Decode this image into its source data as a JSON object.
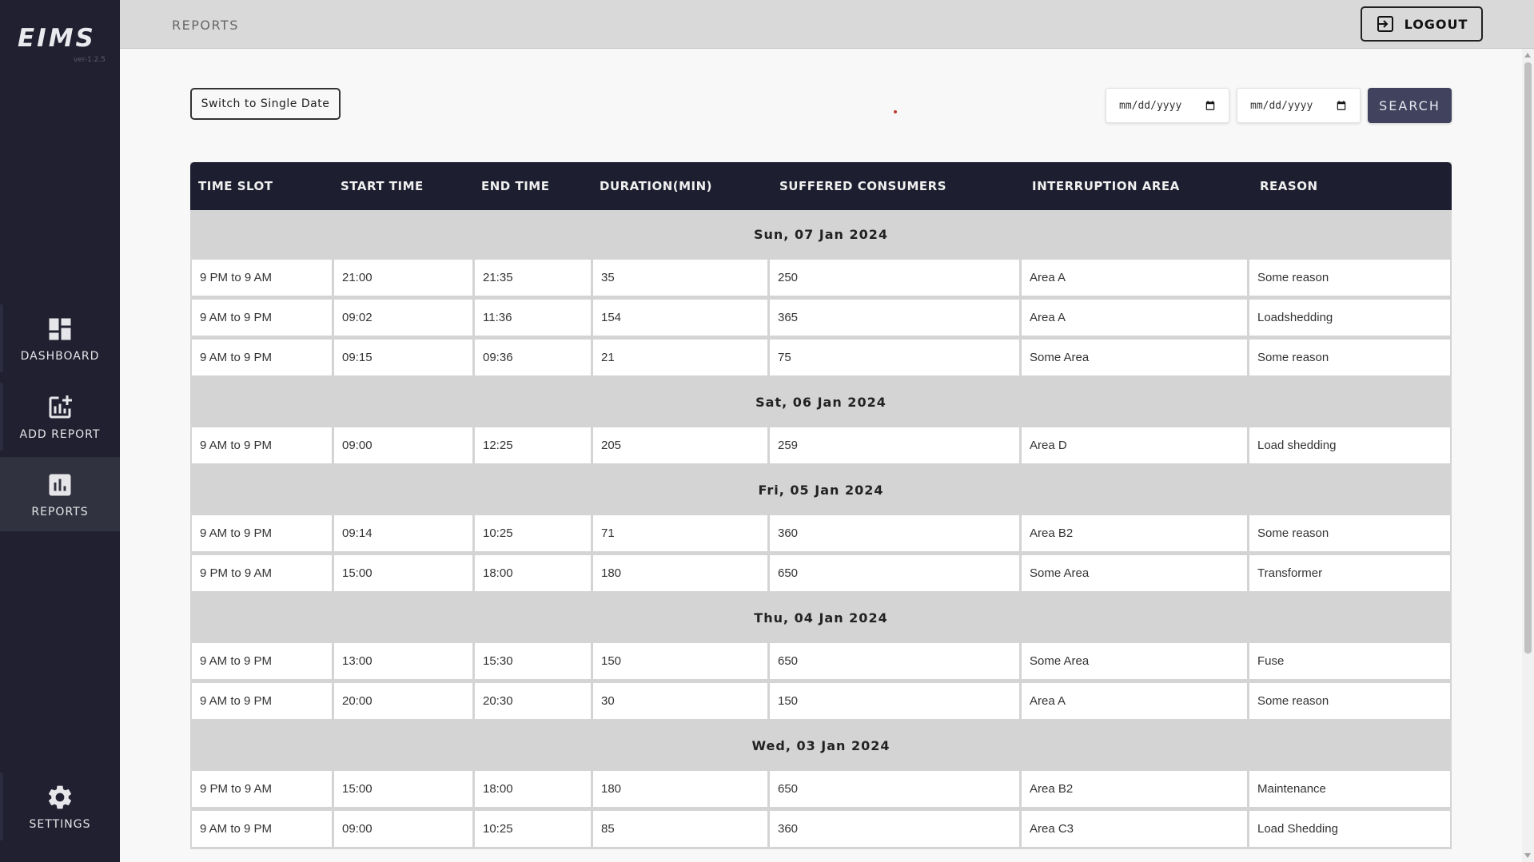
{
  "app": {
    "logo": "EIMS",
    "version": "ver-1.2.5"
  },
  "sidebar": {
    "items": [
      {
        "label": "DASHBOARD",
        "icon": "dashboard-icon"
      },
      {
        "label": "ADD REPORT",
        "icon": "add-chart-icon"
      },
      {
        "label": "REPORTS",
        "icon": "bar-chart-icon",
        "active": true
      },
      {
        "label": "SETTINGS",
        "icon": "gear-icon"
      }
    ]
  },
  "header": {
    "title": "REPORTS",
    "logout_label": "LOGOUT"
  },
  "controls": {
    "switch_label": "Switch to Single Date",
    "date_from_placeholder": "mm/dd/yyyy",
    "date_to_placeholder": "mm/dd/yyyy",
    "search_label": "SEARCH"
  },
  "table": {
    "columns": [
      "TIME SLOT",
      "START TIME",
      "END TIME",
      "DURATION(MIN)",
      "SUFFERED CONSUMERS",
      "INTERRUPTION AREA",
      "REASON"
    ],
    "groups": [
      {
        "date": "Sun, 07 Jan 2024",
        "rows": [
          [
            "9 PM to 9 AM",
            "21:00",
            "21:35",
            "35",
            "250",
            "Area A",
            "Some reason"
          ],
          [
            "9 AM to 9 PM",
            "09:02",
            "11:36",
            "154",
            "365",
            "Area A",
            "Loadshedding"
          ],
          [
            "9 AM to 9 PM",
            "09:15",
            "09:36",
            "21",
            "75",
            "Some Area",
            "Some reason"
          ]
        ]
      },
      {
        "date": "Sat, 06 Jan 2024",
        "rows": [
          [
            "9 AM to 9 PM",
            "09:00",
            "12:25",
            "205",
            "259",
            "Area D",
            "Load shedding"
          ]
        ]
      },
      {
        "date": "Fri, 05 Jan 2024",
        "rows": [
          [
            "9 AM to 9 PM",
            "09:14",
            "10:25",
            "71",
            "360",
            "Area B2",
            "Some reason"
          ],
          [
            "9 PM to 9 AM",
            "15:00",
            "18:00",
            "180",
            "650",
            "Some Area",
            "Transformer"
          ]
        ]
      },
      {
        "date": "Thu, 04 Jan 2024",
        "rows": [
          [
            "9 AM to 9 PM",
            "13:00",
            "15:30",
            "150",
            "650",
            "Some Area",
            "Fuse"
          ],
          [
            "9 AM to 9 PM",
            "20:00",
            "20:30",
            "30",
            "150",
            "Area A",
            "Some reason"
          ]
        ]
      },
      {
        "date": "Wed, 03 Jan 2024",
        "rows": [
          [
            "9 PM to 9 AM",
            "15:00",
            "18:00",
            "180",
            "650",
            "Area B2",
            "Maintenance"
          ],
          [
            "9 AM to 9 PM",
            "09:00",
            "10:25",
            "85",
            "360",
            "Area C3",
            "Load Shedding"
          ]
        ]
      }
    ]
  }
}
